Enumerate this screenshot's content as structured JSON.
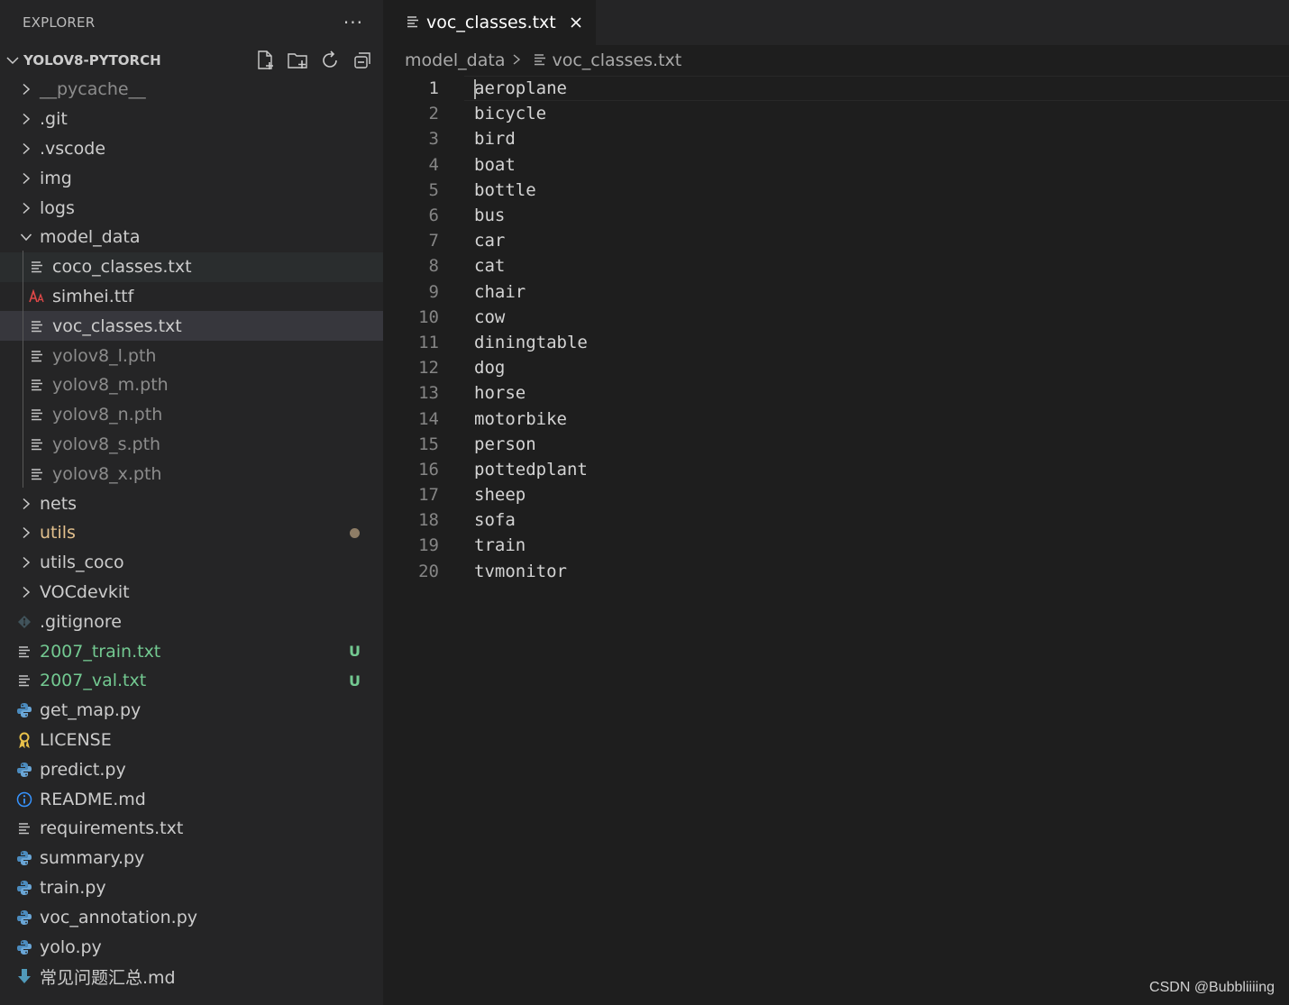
{
  "explorer": {
    "title": "EXPLORER",
    "more": "···",
    "project": "YOLOV8-PYTORCH"
  },
  "tree": [
    {
      "label": "__pycache__",
      "type": "folder",
      "depth": 0,
      "state": "dim"
    },
    {
      "label": ".git",
      "type": "folder",
      "depth": 0
    },
    {
      "label": ".vscode",
      "type": "folder",
      "depth": 0
    },
    {
      "label": "img",
      "type": "folder",
      "depth": 0
    },
    {
      "label": "logs",
      "type": "folder",
      "depth": 0
    },
    {
      "label": "model_data",
      "type": "folder",
      "depth": 0,
      "open": true
    },
    {
      "label": "coco_classes.txt",
      "type": "txt",
      "depth": 1,
      "row": "hover"
    },
    {
      "label": "simhei.ttf",
      "type": "font",
      "depth": 1
    },
    {
      "label": "voc_classes.txt",
      "type": "txt",
      "depth": 1,
      "row": "selected"
    },
    {
      "label": "yolov8_l.pth",
      "type": "txt",
      "depth": 1,
      "state": "dim"
    },
    {
      "label": "yolov8_m.pth",
      "type": "txt",
      "depth": 1,
      "state": "dim"
    },
    {
      "label": "yolov8_n.pth",
      "type": "txt",
      "depth": 1,
      "state": "dim"
    },
    {
      "label": "yolov8_s.pth",
      "type": "txt",
      "depth": 1,
      "state": "dim"
    },
    {
      "label": "yolov8_x.pth",
      "type": "txt",
      "depth": 1,
      "state": "dim"
    },
    {
      "label": "nets",
      "type": "folder",
      "depth": 0
    },
    {
      "label": "utils",
      "type": "folder",
      "depth": 0,
      "state": "modified",
      "dot": true
    },
    {
      "label": "utils_coco",
      "type": "folder",
      "depth": 0
    },
    {
      "label": "VOCdevkit",
      "type": "folder",
      "depth": 0
    },
    {
      "label": ".gitignore",
      "type": "git",
      "depth": 0
    },
    {
      "label": "2007_train.txt",
      "type": "txt",
      "depth": 0,
      "state": "untracked",
      "badge": "U"
    },
    {
      "label": "2007_val.txt",
      "type": "txt",
      "depth": 0,
      "state": "untracked",
      "badge": "U"
    },
    {
      "label": "get_map.py",
      "type": "py",
      "depth": 0
    },
    {
      "label": "LICENSE",
      "type": "license",
      "depth": 0
    },
    {
      "label": "predict.py",
      "type": "py",
      "depth": 0
    },
    {
      "label": "README.md",
      "type": "info",
      "depth": 0
    },
    {
      "label": "requirements.txt",
      "type": "txt",
      "depth": 0
    },
    {
      "label": "summary.py",
      "type": "py",
      "depth": 0
    },
    {
      "label": "train.py",
      "type": "py",
      "depth": 0
    },
    {
      "label": "voc_annotation.py",
      "type": "py",
      "depth": 0
    },
    {
      "label": "yolo.py",
      "type": "py",
      "depth": 0
    },
    {
      "label": "常见问题汇总.md",
      "type": "md-down",
      "depth": 0
    }
  ],
  "tab": {
    "label": "voc_classes.txt",
    "close": "✕"
  },
  "breadcrumb": {
    "folder": "model_data",
    "file": "voc_classes.txt"
  },
  "lines": [
    "aeroplane",
    "bicycle",
    "bird",
    "boat",
    "bottle",
    "bus",
    "car",
    "cat",
    "chair",
    "cow",
    "diningtable",
    "dog",
    "horse",
    "motorbike",
    "person",
    "pottedplant",
    "sheep",
    "sofa",
    "train",
    "tvmonitor"
  ],
  "current_line": 1,
  "watermark": "CSDN @Bubbliiiing",
  "colors": {
    "accent_untracked": "#73c991",
    "modified": "#e2c08d",
    "python": "#4b8bbe",
    "font_icon": "#e04848",
    "info": "#3794ff"
  }
}
